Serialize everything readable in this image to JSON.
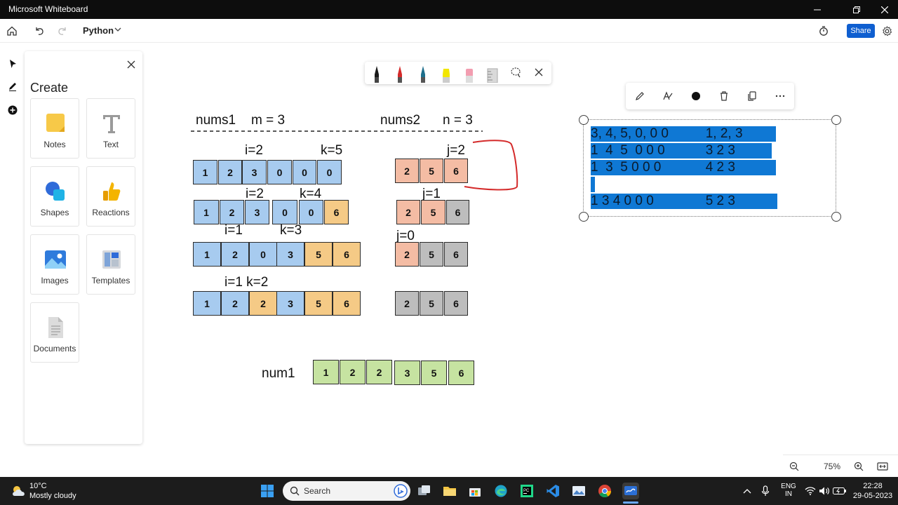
{
  "window": {
    "title": "Microsoft Whiteboard"
  },
  "appbar": {
    "board_name": "Python",
    "share_label": "Share"
  },
  "create_panel": {
    "heading": "Create",
    "items": [
      {
        "label": "Notes",
        "icon": "sticky-note-icon"
      },
      {
        "label": "Text",
        "icon": "text-icon"
      },
      {
        "label": "Shapes",
        "icon": "shapes-icon"
      },
      {
        "label": "Reactions",
        "icon": "thumbs-up-icon"
      },
      {
        "label": "Images",
        "icon": "image-icon"
      },
      {
        "label": "Templates",
        "icon": "templates-icon"
      },
      {
        "label": "Documents",
        "icon": "document-icon"
      }
    ]
  },
  "pen_toolbar": {
    "pens": [
      {
        "name": "black-pen-icon",
        "color": "#1a1a1a"
      },
      {
        "name": "red-pen-icon",
        "color": "#d42a2a"
      },
      {
        "name": "teal-pen-icon",
        "color": "#1e6f8c"
      },
      {
        "name": "highlighter-icon",
        "color": "#f2e600"
      },
      {
        "name": "eraser-icon",
        "color": "#f29db0"
      },
      {
        "name": "ruler-icon",
        "color": "#b7b7b7"
      }
    ]
  },
  "canvas": {
    "headers": {
      "nums1": "nums1",
      "m": "m = 3",
      "nums2": "nums2",
      "n": "n = 3"
    },
    "rows": [
      {
        "labels": [
          {
            "text": "i=2"
          },
          {
            "text": "k=5"
          }
        ],
        "cells": [
          {
            "v": "1",
            "c": "blue"
          },
          {
            "v": "2",
            "c": "blue"
          },
          {
            "v": "3",
            "c": "blue"
          },
          {
            "v": "0",
            "c": "blue"
          },
          {
            "v": "0",
            "c": "blue"
          },
          {
            "v": "0",
            "c": "blue"
          }
        ],
        "label2": "j=2",
        "cells2": [
          {
            "v": "2",
            "c": "peach"
          },
          {
            "v": "5",
            "c": "peach"
          },
          {
            "v": "6",
            "c": "peach"
          }
        ]
      },
      {
        "labels": [
          {
            "text": "i=2"
          },
          {
            "text": "k=4"
          }
        ],
        "cells": [
          {
            "v": "1",
            "c": "blue"
          },
          {
            "v": "2",
            "c": "blue"
          },
          {
            "v": "3",
            "c": "blue"
          },
          {
            "v": "0",
            "c": "blue"
          },
          {
            "v": "0",
            "c": "blue"
          },
          {
            "v": "6",
            "c": "orange"
          }
        ],
        "label2": "j=1",
        "cells2": [
          {
            "v": "2",
            "c": "peach"
          },
          {
            "v": "5",
            "c": "peach"
          },
          {
            "v": "6",
            "c": "gray"
          }
        ]
      },
      {
        "labels": [
          {
            "text": "i=1"
          },
          {
            "text": "k=3"
          }
        ],
        "cells": [
          {
            "v": "1",
            "c": "blue"
          },
          {
            "v": "2",
            "c": "blue"
          },
          {
            "v": "0",
            "c": "blue"
          },
          {
            "v": "3",
            "c": "blue"
          },
          {
            "v": "5",
            "c": "orange"
          },
          {
            "v": "6",
            "c": "orange"
          }
        ],
        "label2": "j=0",
        "cells2": [
          {
            "v": "2",
            "c": "peach"
          },
          {
            "v": "5",
            "c": "gray"
          },
          {
            "v": "6",
            "c": "gray"
          }
        ]
      },
      {
        "labels": [
          {
            "text": "i=1 k=2"
          }
        ],
        "cells": [
          {
            "v": "1",
            "c": "blue"
          },
          {
            "v": "2",
            "c": "blue"
          },
          {
            "v": "2",
            "c": "orange"
          },
          {
            "v": "3",
            "c": "blue"
          },
          {
            "v": "5",
            "c": "orange"
          },
          {
            "v": "6",
            "c": "orange"
          }
        ],
        "label2": "",
        "cells2": [
          {
            "v": "2",
            "c": "gray"
          },
          {
            "v": "5",
            "c": "gray"
          },
          {
            "v": "6",
            "c": "gray"
          }
        ]
      }
    ],
    "result": {
      "label": "num1",
      "cells": [
        {
          "v": "1"
        },
        {
          "v": "2"
        },
        {
          "v": "2"
        },
        {
          "v": "3"
        },
        {
          "v": "5"
        },
        {
          "v": "6"
        }
      ]
    },
    "highlighted_lines": [
      "3, 4, 5, 0, 0 0          1, 2, 3",
      "1  4  5  0 0 0           3 2 3",
      "1  3  5 0 0 0            4 2 3",
      " ",
      "1 3 4 0 0 0              5 2 3"
    ]
  },
  "zoom": {
    "value": "75%"
  },
  "taskbar": {
    "weather_temp": "10°C",
    "weather_desc": "Mostly cloudy",
    "search_placeholder": "Search",
    "lang_line1": "ENG",
    "lang_line2": "IN",
    "time": "22:28",
    "date": "29-05-2023"
  },
  "colors": {
    "accent": "#0f5fd0",
    "highlight": "#0f78d4",
    "ink_red": "#d42a2a"
  }
}
